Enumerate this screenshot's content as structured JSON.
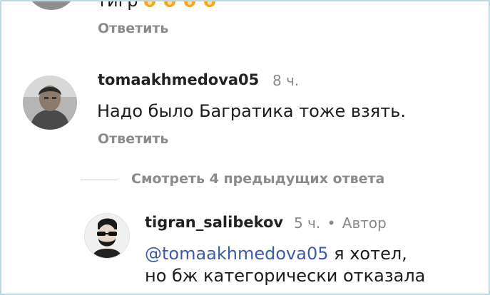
{
  "comment_prev": {
    "text_fragment": "тигр",
    "emoji": [
      "fire-emoji",
      "fire-emoji",
      "fire-emoji",
      "fire-emoji"
    ],
    "reply_label": "Ответить"
  },
  "comment1": {
    "username": "tomaakhmedova05",
    "time": "8 ч.",
    "text": "Надо было Багратика тоже взять.",
    "reply_label": "Ответить"
  },
  "view_replies": {
    "label": "Смотреть 4 предыдущих ответа"
  },
  "reply1": {
    "username": "tigran_salibekov",
    "time": "5 ч.",
    "separator": "•",
    "author_badge": "Автор",
    "mention": "@tomaakhmedova05",
    "text_line1": " я хотел,",
    "text_line2": "но бж категорически отказала"
  },
  "colors": {
    "mention": "#3e5ba8",
    "muted": "#8a8a8a",
    "fire": "#f5a623"
  }
}
